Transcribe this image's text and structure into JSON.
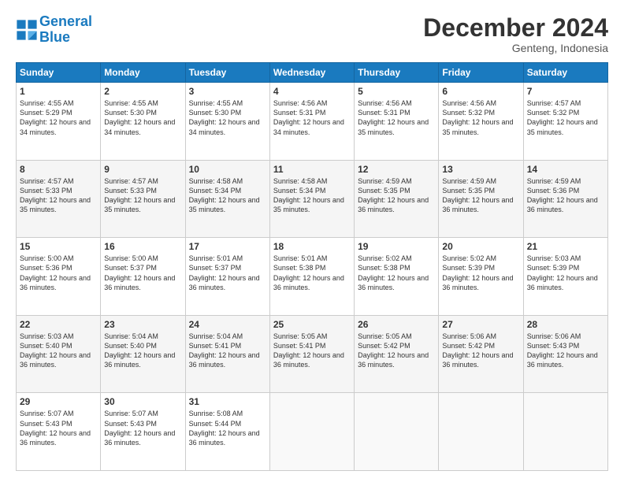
{
  "logo": {
    "line1": "General",
    "line2": "Blue"
  },
  "header": {
    "month": "December 2024",
    "location": "Genteng, Indonesia"
  },
  "weekdays": [
    "Sunday",
    "Monday",
    "Tuesday",
    "Wednesday",
    "Thursday",
    "Friday",
    "Saturday"
  ],
  "weeks": [
    [
      {
        "day": "1",
        "sunrise": "4:55 AM",
        "sunset": "5:29 PM",
        "daylight": "12 hours and 34 minutes."
      },
      {
        "day": "2",
        "sunrise": "4:55 AM",
        "sunset": "5:30 PM",
        "daylight": "12 hours and 34 minutes."
      },
      {
        "day": "3",
        "sunrise": "4:55 AM",
        "sunset": "5:30 PM",
        "daylight": "12 hours and 34 minutes."
      },
      {
        "day": "4",
        "sunrise": "4:56 AM",
        "sunset": "5:31 PM",
        "daylight": "12 hours and 34 minutes."
      },
      {
        "day": "5",
        "sunrise": "4:56 AM",
        "sunset": "5:31 PM",
        "daylight": "12 hours and 35 minutes."
      },
      {
        "day": "6",
        "sunrise": "4:56 AM",
        "sunset": "5:32 PM",
        "daylight": "12 hours and 35 minutes."
      },
      {
        "day": "7",
        "sunrise": "4:57 AM",
        "sunset": "5:32 PM",
        "daylight": "12 hours and 35 minutes."
      }
    ],
    [
      {
        "day": "8",
        "sunrise": "4:57 AM",
        "sunset": "5:33 PM",
        "daylight": "12 hours and 35 minutes."
      },
      {
        "day": "9",
        "sunrise": "4:57 AM",
        "sunset": "5:33 PM",
        "daylight": "12 hours and 35 minutes."
      },
      {
        "day": "10",
        "sunrise": "4:58 AM",
        "sunset": "5:34 PM",
        "daylight": "12 hours and 35 minutes."
      },
      {
        "day": "11",
        "sunrise": "4:58 AM",
        "sunset": "5:34 PM",
        "daylight": "12 hours and 35 minutes."
      },
      {
        "day": "12",
        "sunrise": "4:59 AM",
        "sunset": "5:35 PM",
        "daylight": "12 hours and 36 minutes."
      },
      {
        "day": "13",
        "sunrise": "4:59 AM",
        "sunset": "5:35 PM",
        "daylight": "12 hours and 36 minutes."
      },
      {
        "day": "14",
        "sunrise": "4:59 AM",
        "sunset": "5:36 PM",
        "daylight": "12 hours and 36 minutes."
      }
    ],
    [
      {
        "day": "15",
        "sunrise": "5:00 AM",
        "sunset": "5:36 PM",
        "daylight": "12 hours and 36 minutes."
      },
      {
        "day": "16",
        "sunrise": "5:00 AM",
        "sunset": "5:37 PM",
        "daylight": "12 hours and 36 minutes."
      },
      {
        "day": "17",
        "sunrise": "5:01 AM",
        "sunset": "5:37 PM",
        "daylight": "12 hours and 36 minutes."
      },
      {
        "day": "18",
        "sunrise": "5:01 AM",
        "sunset": "5:38 PM",
        "daylight": "12 hours and 36 minutes."
      },
      {
        "day": "19",
        "sunrise": "5:02 AM",
        "sunset": "5:38 PM",
        "daylight": "12 hours and 36 minutes."
      },
      {
        "day": "20",
        "sunrise": "5:02 AM",
        "sunset": "5:39 PM",
        "daylight": "12 hours and 36 minutes."
      },
      {
        "day": "21",
        "sunrise": "5:03 AM",
        "sunset": "5:39 PM",
        "daylight": "12 hours and 36 minutes."
      }
    ],
    [
      {
        "day": "22",
        "sunrise": "5:03 AM",
        "sunset": "5:40 PM",
        "daylight": "12 hours and 36 minutes."
      },
      {
        "day": "23",
        "sunrise": "5:04 AM",
        "sunset": "5:40 PM",
        "daylight": "12 hours and 36 minutes."
      },
      {
        "day": "24",
        "sunrise": "5:04 AM",
        "sunset": "5:41 PM",
        "daylight": "12 hours and 36 minutes."
      },
      {
        "day": "25",
        "sunrise": "5:05 AM",
        "sunset": "5:41 PM",
        "daylight": "12 hours and 36 minutes."
      },
      {
        "day": "26",
        "sunrise": "5:05 AM",
        "sunset": "5:42 PM",
        "daylight": "12 hours and 36 minutes."
      },
      {
        "day": "27",
        "sunrise": "5:06 AM",
        "sunset": "5:42 PM",
        "daylight": "12 hours and 36 minutes."
      },
      {
        "day": "28",
        "sunrise": "5:06 AM",
        "sunset": "5:43 PM",
        "daylight": "12 hours and 36 minutes."
      }
    ],
    [
      {
        "day": "29",
        "sunrise": "5:07 AM",
        "sunset": "5:43 PM",
        "daylight": "12 hours and 36 minutes."
      },
      {
        "day": "30",
        "sunrise": "5:07 AM",
        "sunset": "5:43 PM",
        "daylight": "12 hours and 36 minutes."
      },
      {
        "day": "31",
        "sunrise": "5:08 AM",
        "sunset": "5:44 PM",
        "daylight": "12 hours and 36 minutes."
      },
      null,
      null,
      null,
      null
    ]
  ]
}
